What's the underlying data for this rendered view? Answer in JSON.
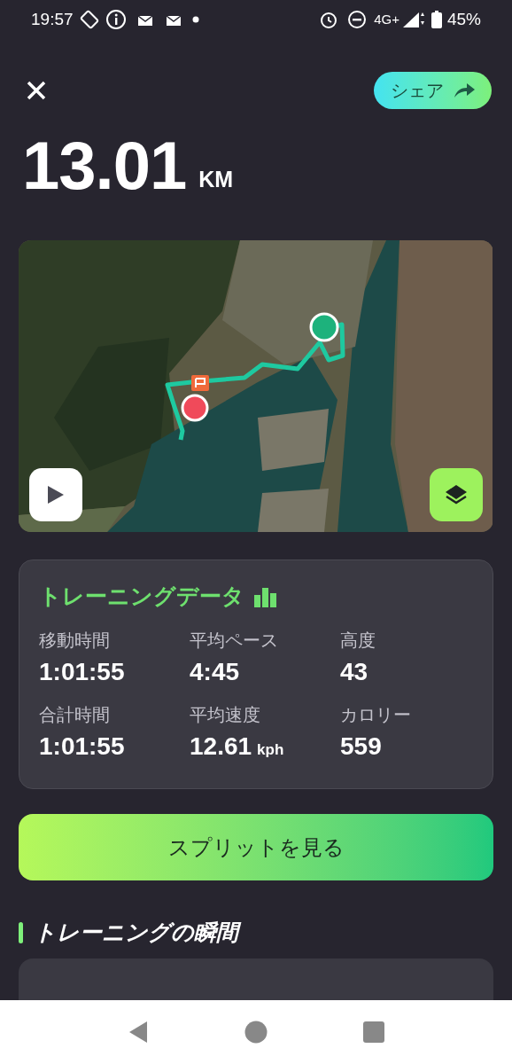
{
  "status_bar": {
    "time": "19:57",
    "network": "4G+",
    "battery": "45%"
  },
  "header": {
    "share_button": "シェア"
  },
  "distance": {
    "value": "13.01",
    "unit": "KM"
  },
  "training_data": {
    "title": "トレーニングデータ",
    "stats": [
      {
        "label": "移動時間",
        "value": "1:01:55"
      },
      {
        "label": "平均ペース",
        "value": "4:45"
      },
      {
        "label": "高度",
        "value": "43"
      },
      {
        "label": "合計時間",
        "value": "1:01:55"
      },
      {
        "label": "平均速度",
        "value": "12.61",
        "unit": "kph"
      },
      {
        "label": "カロリー",
        "value": "559"
      }
    ]
  },
  "splits_button": "スプリットを見る",
  "moments": {
    "title": "トレーニングの瞬間"
  }
}
